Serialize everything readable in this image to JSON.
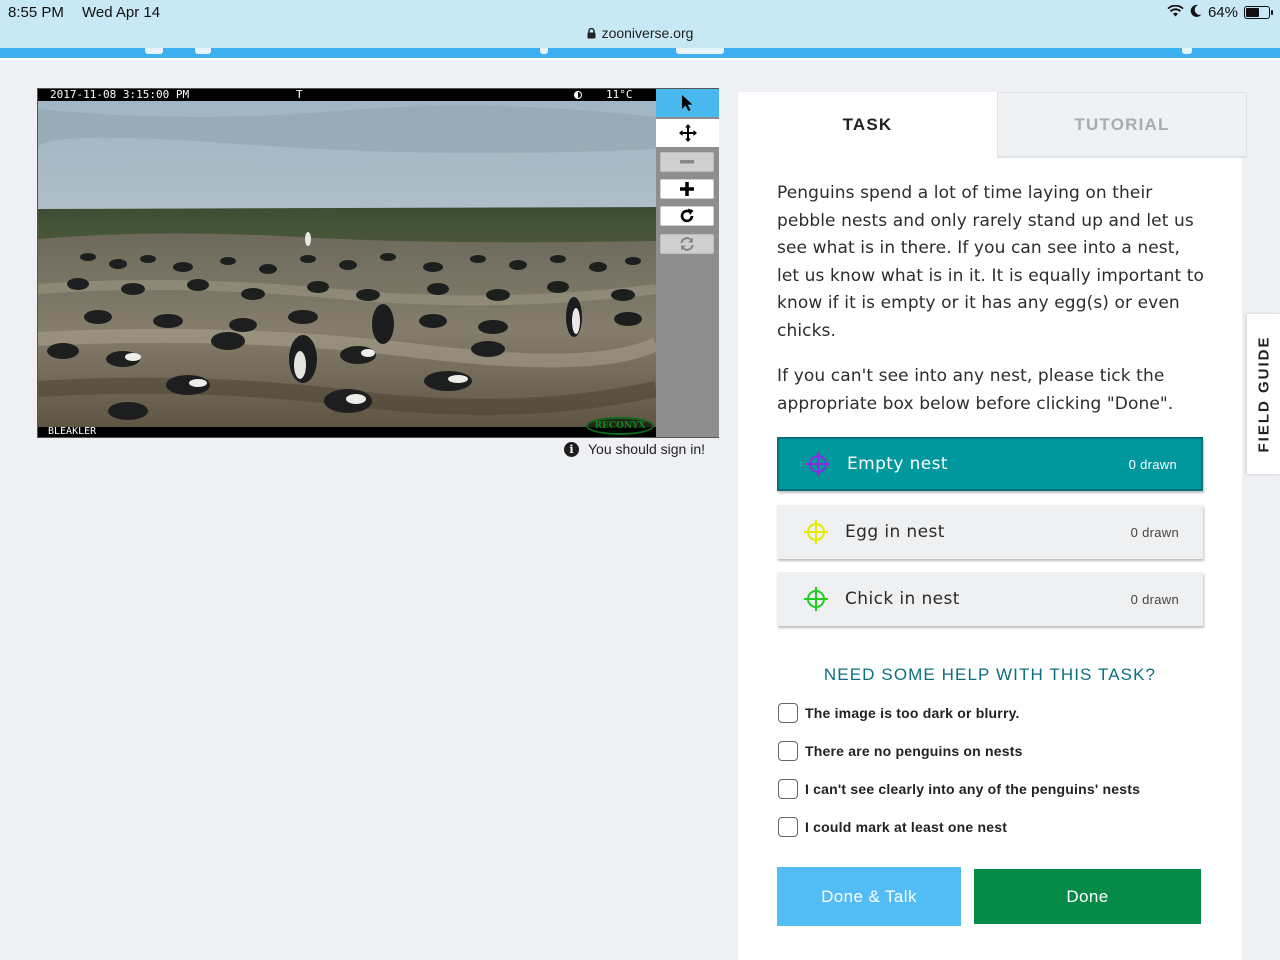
{
  "status_bar": {
    "time": "8:55 PM",
    "date": "Wed Apr 14",
    "url": "zooniverse.org",
    "battery": "64%",
    "battery_level": 0.64
  },
  "subject": {
    "timestamp": "2017-11-08 3:15:00 PM",
    "trigger": "T",
    "temperature": "11°C",
    "location": "BLEAKLER",
    "brand": "RECONYX"
  },
  "viewer_tools": [
    {
      "name": "pointer-icon",
      "active": true
    },
    {
      "name": "pan-icon",
      "active": false
    },
    {
      "name": "zoom-out-icon",
      "active": false,
      "disabled": true
    },
    {
      "name": "zoom-in-icon",
      "active": false
    },
    {
      "name": "rotate-icon",
      "active": false
    },
    {
      "name": "reset-icon",
      "active": false,
      "disabled": true
    }
  ],
  "sign_in_notice": "You should sign in!",
  "tabs": {
    "task": "TASK",
    "tutorial": "TUTORIAL"
  },
  "instructions": {
    "p1": "Penguins spend a lot of time laying on their pebble nests and only rarely stand up and let us see what is in there. If you can see into a nest, let us know what is in it. It is equally important to know if it is empty or it has any egg(s) or even chicks.",
    "p2": "If you can't see into any nest, please tick the appropriate box below before clicking \"Done\"."
  },
  "drawing_tools": [
    {
      "label": "Empty nest",
      "count": "0 drawn",
      "color": "#8a2be2",
      "selected": true
    },
    {
      "label": "Egg in nest",
      "count": "0 drawn",
      "color": "#e8e800",
      "selected": false
    },
    {
      "label": "Chick in nest",
      "count": "0 drawn",
      "color": "#22cc22",
      "selected": false
    }
  ],
  "help_title": "NEED SOME HELP WITH THIS TASK?",
  "checkboxes": [
    {
      "label": "The image is too dark or blurry.",
      "checked": false
    },
    {
      "label": "There are no penguins on nests",
      "checked": false
    },
    {
      "label": "I can't see clearly into any of the penguins' nests",
      "checked": false
    },
    {
      "label": "I could mark at least one nest",
      "checked": false
    }
  ],
  "buttons": {
    "done_talk": "Done & Talk",
    "done": "Done"
  },
  "field_guide": "FIELD GUIDE",
  "colors": {
    "accent_teal": "#00979d",
    "done_green": "#058a47",
    "talk_blue": "#52bcf5",
    "help_title": "#0c6f80"
  }
}
